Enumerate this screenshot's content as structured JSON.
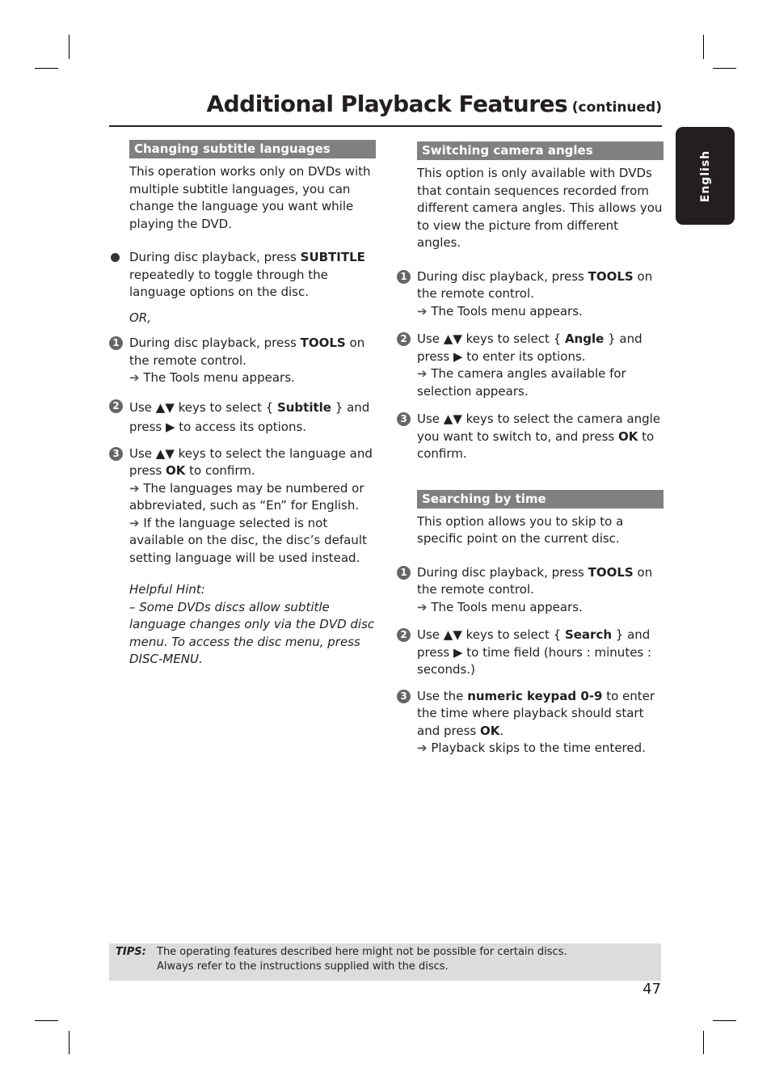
{
  "header": {
    "title": "Additional Playback Features",
    "continued": "(continued)"
  },
  "language_tab": "English",
  "left_column": {
    "section_title": "Changing subtitle languages",
    "intro": "This operation works only on DVDs with multiple subtitle languages, you can change the language you want while playing the DVD.",
    "bullet": {
      "pre": "During disc playback, press ",
      "bold": "SUBTITLE",
      "post": " repeatedly to toggle through the language options on the disc."
    },
    "or_label": "OR,",
    "steps": [
      {
        "num": "1",
        "pre": "During disc playback, press ",
        "bold": "TOOLS",
        "post": " on the remote control.",
        "results": [
          "The Tools menu appears."
        ]
      },
      {
        "num": "2",
        "pre": "Use ▲▼ keys to select { ",
        "bold": "Subtitle",
        "post": " } and press ▶ to access its options.",
        "results": []
      },
      {
        "num": "3",
        "pre": "Use ▲▼ keys to select the language and press ",
        "bold": "OK",
        "post": " to confirm.",
        "results": [
          "The languages may be numbered or abbreviated, such as “En” for English.",
          "If the language selected is not available on the disc, the disc’s default setting language will be used instead."
        ]
      }
    ],
    "hint_title": "Helpful Hint:",
    "hint_text": "– Some DVDs discs allow subtitle language changes only via the DVD disc menu. To access the disc menu, press DISC-MENU."
  },
  "right_column": {
    "section1": {
      "title": "Switching camera angles",
      "intro": "This option is only available with DVDs that contain sequences recorded from different camera angles. This allows you to view the picture from different angles.",
      "steps": [
        {
          "num": "1",
          "pre": "During disc playback, press ",
          "bold": "TOOLS",
          "post": " on the remote control.",
          "results": [
            "The Tools menu appears."
          ]
        },
        {
          "num": "2",
          "pre": "Use ▲▼ keys to select { ",
          "bold": "Angle",
          "post": " } and press ▶ to enter its options.",
          "results": [
            "The camera angles available for selection appears."
          ]
        },
        {
          "num": "3",
          "pre": "Use ▲▼ keys to select the camera angle you want to switch to, and press ",
          "bold": "OK",
          "post": " to confirm.",
          "results": []
        }
      ]
    },
    "section2": {
      "title": "Searching by time",
      "intro": "This option allows you to skip to a specific point on the current disc.",
      "steps": [
        {
          "num": "1",
          "pre": "During disc playback, press ",
          "bold": "TOOLS",
          "post": " on the remote control.",
          "results": [
            "The Tools menu appears."
          ]
        },
        {
          "num": "2",
          "pre": "Use ▲▼ keys to select { ",
          "bold": "Search",
          "post": " } and press ▶ to time field (hours : minutes : seconds.)",
          "results": []
        },
        {
          "num": "3",
          "pre": "Use the ",
          "bold": "numeric keypad 0-9",
          "post": " to enter the time where playback should start and press ",
          "bold2": "OK",
          "post2": ".",
          "results": [
            "Playback skips to the time entered."
          ]
        }
      ]
    }
  },
  "tips": {
    "label": "TIPS:",
    "line1": "The operating features described here might not be possible for certain discs.",
    "line2": "Always refer to the instructions supplied with the discs."
  },
  "page_number": "47",
  "arrow_glyph": "➔"
}
